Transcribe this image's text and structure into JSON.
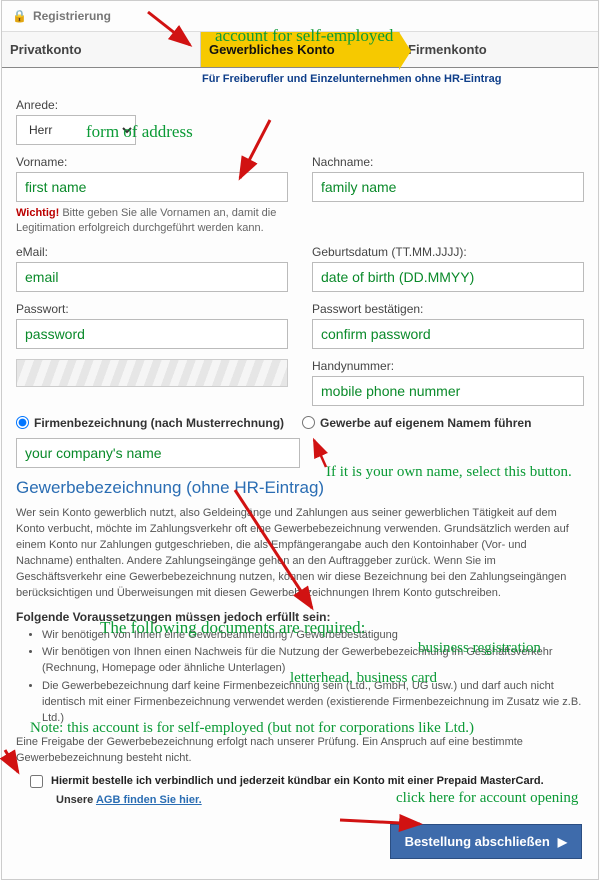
{
  "header": {
    "title": "Registrierung"
  },
  "tabs": {
    "items": [
      {
        "label": "Privatkonto"
      },
      {
        "label": "Gewerbliches Konto"
      },
      {
        "label": "Firmenkonto"
      }
    ],
    "active_desc": "Für Freiberufler und Einzelunternehmen ohne HR-Eintrag"
  },
  "form": {
    "anrede_label": "Anrede:",
    "anrede_value": "Herr",
    "vorname_label": "Vorname:",
    "vorname_value": "first name",
    "vorname_hint_prefix": "Wichtig!",
    "vorname_hint": " Bitte geben Sie alle Vornamen an, damit die Legitimation erfolgreich durchgeführt werden kann.",
    "nachname_label": "Nachname:",
    "nachname_value": "family name",
    "email_label": "eMail:",
    "email_value": "email",
    "dob_label": "Geburtsdatum (TT.MM.JJJJ):",
    "dob_value": "date of birth (DD.MMYY)",
    "pw_label": "Passwort:",
    "pw_value": "password",
    "pw2_label": "Passwort bestätigen:",
    "pw2_value": "confirm password",
    "mobile_label": "Handynummer:",
    "mobile_value": "mobile phone nummer",
    "company_option1": "Firmenbezeichnung (nach Musterrechnung)",
    "company_option2": "Gewerbe auf eigenem Namem führen",
    "company_value": "your company's name"
  },
  "section": {
    "heading": "Gewerbebezeichnung (ohne HR-Eintrag)",
    "body": "Wer sein Konto gewerblich nutzt, also Geldeingänge und Zahlungen aus seiner gewerblichen Tätigkeit auf dem Konto verbucht, möchte im Zahlungsverkehr oft eine Gewerbebezeichnung verwenden. Grundsätzlich werden auf einem Konto nur Zahlungen gutgeschrieben, die als Empfängerangabe auch den Kontoinhaber (Vor- und Nachname) enthalten. Andere Zahlungseingänge gehen an den Auftraggeber zurück. Wenn Sie im Geschäftsverkehr eine Gewerbebezeichnung nutzen, können wir diese Bezeichnung bei den Zahlungseingängen berücksichtigen und Überweisungen mit diesen Gewerbebezeichnungen Ihrem Konto gutschreiben.",
    "sub": "Folgende Voraussetzungen müssen jedoch erfüllt sein:",
    "req1": "Wir benötigen von Ihnen eine Gewerbeanmeldung / Gewerbebestätigung",
    "req2": "Wir benötigen von Ihnen einen Nachweis für die Nutzung der Gewerbebezeichnung im Geschäftsverkehr (Rechnung, Homepage oder ähnliche Unterlagen)",
    "req3": "Die Gewerbebezeichnung darf keine Firmenbezeichnung sein (Ltd., GmbH, UG usw.) und darf auch nicht identisch mit einer Firmenbezeichnung verwendet werden (existierende Firmenbezeichnung im Zusatz wie z.B. Ltd.)",
    "freigabe": "Eine Freigabe der Gewerbebezeichnung erfolgt nach unserer Prüfung. Ein Anspruch auf eine bestimmte Gewerbebezeichnung besteht nicht.",
    "consent": "Hiermit bestelle ich verbindlich und jederzeit kündbar ein Konto mit einer Prepaid MasterCard.",
    "agb_prefix": "Unsere ",
    "agb_link": "AGB finden Sie hier."
  },
  "submit": {
    "label": "Bestellung abschließen"
  },
  "annotations": {
    "self_employed": "account for self-employed",
    "form_of_address": "form of address",
    "own_name": "If it is your own name, select this button.",
    "docs_required": "The following documents are required:",
    "biz_reg": "business registration",
    "letterhead": "letterhead, business card",
    "note": "Note: this account is for self-employed (but not for corporations like Ltd.)",
    "click_here": "click here for account opening"
  },
  "colors": {
    "tab_active": "#f6c900",
    "link": "#2a6db3",
    "annotation": "#0b9a36",
    "arrow": "#d11212",
    "submit": "#3e6bab"
  }
}
